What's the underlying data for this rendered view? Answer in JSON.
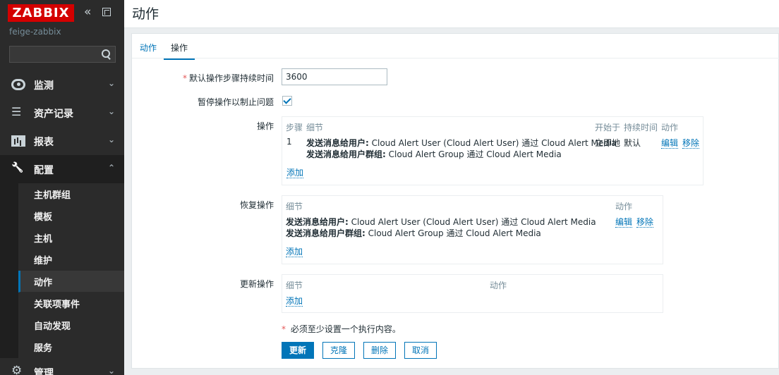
{
  "sidebar": {
    "logo": "ZABBIX",
    "server_name": "feige-zabbix",
    "search": {
      "value": "",
      "placeholder": ""
    },
    "menu": [
      {
        "label": "监测",
        "icon": "eye-icon",
        "chevron": "⌄"
      },
      {
        "label": "资产记录",
        "icon": "list-icon",
        "chevron": "⌄"
      },
      {
        "label": "报表",
        "icon": "report-icon",
        "chevron": "⌄"
      },
      {
        "label": "配置",
        "icon": "wrench-icon",
        "chevron": "⌃"
      },
      {
        "label": "管理",
        "icon": "gear-icon",
        "chevron": "⌄"
      }
    ],
    "submenu": [
      "主机群组",
      "模板",
      "主机",
      "维护",
      "动作",
      "关联项事件",
      "自动发现",
      "服务"
    ],
    "active_submenu": "动作"
  },
  "header": {
    "title": "动作"
  },
  "tabs": [
    "动作",
    "操作"
  ],
  "form": {
    "default_duration_label": "默认操作步骤持续时间",
    "default_duration_value": "3600",
    "pause_label": "暂停操作以制止问题",
    "pause_checked": true,
    "operations": {
      "label": "操作",
      "headers": {
        "steps": "步骤",
        "details": "细节",
        "start_in": "开始于",
        "duration": "持续时间",
        "action": "动作"
      },
      "rows": [
        {
          "step": "1",
          "line1_bold": "发送消息给用户:",
          "line1_text": " Cloud Alert User (Cloud Alert User) 通过 Cloud Alert Media",
          "line2_bold": "发送消息给用户群组:",
          "line2_text": " Cloud Alert Group 通过 Cloud Alert Media",
          "start_in": "立即地",
          "duration": "默认",
          "edit": "编辑",
          "remove": "移除"
        }
      ],
      "add": "添加"
    },
    "recovery": {
      "label": "恢复操作",
      "headers": {
        "details": "细节",
        "action": "动作"
      },
      "line1_bold": "发送消息给用户:",
      "line1_text": " Cloud Alert User (Cloud Alert User) 通过 Cloud Alert Media",
      "line2_bold": "发送消息给用户群组:",
      "line2_text": " Cloud Alert Group 通过 Cloud Alert Media",
      "edit": "编辑",
      "remove": "移除",
      "add": "添加"
    },
    "update": {
      "label": "更新操作",
      "headers": {
        "details": "细节",
        "action": "动作"
      },
      "add": "添加"
    },
    "note_star": "*",
    "note": " 必须至少设置一个执行内容。"
  },
  "buttons": {
    "update": "更新",
    "clone": "克隆",
    "delete": "删除",
    "cancel": "取消"
  },
  "colors": {
    "accent": "#0275b8",
    "logo_red": "#d40000",
    "sidebar_bg": "#2b2b2b",
    "required": "#e45959"
  }
}
